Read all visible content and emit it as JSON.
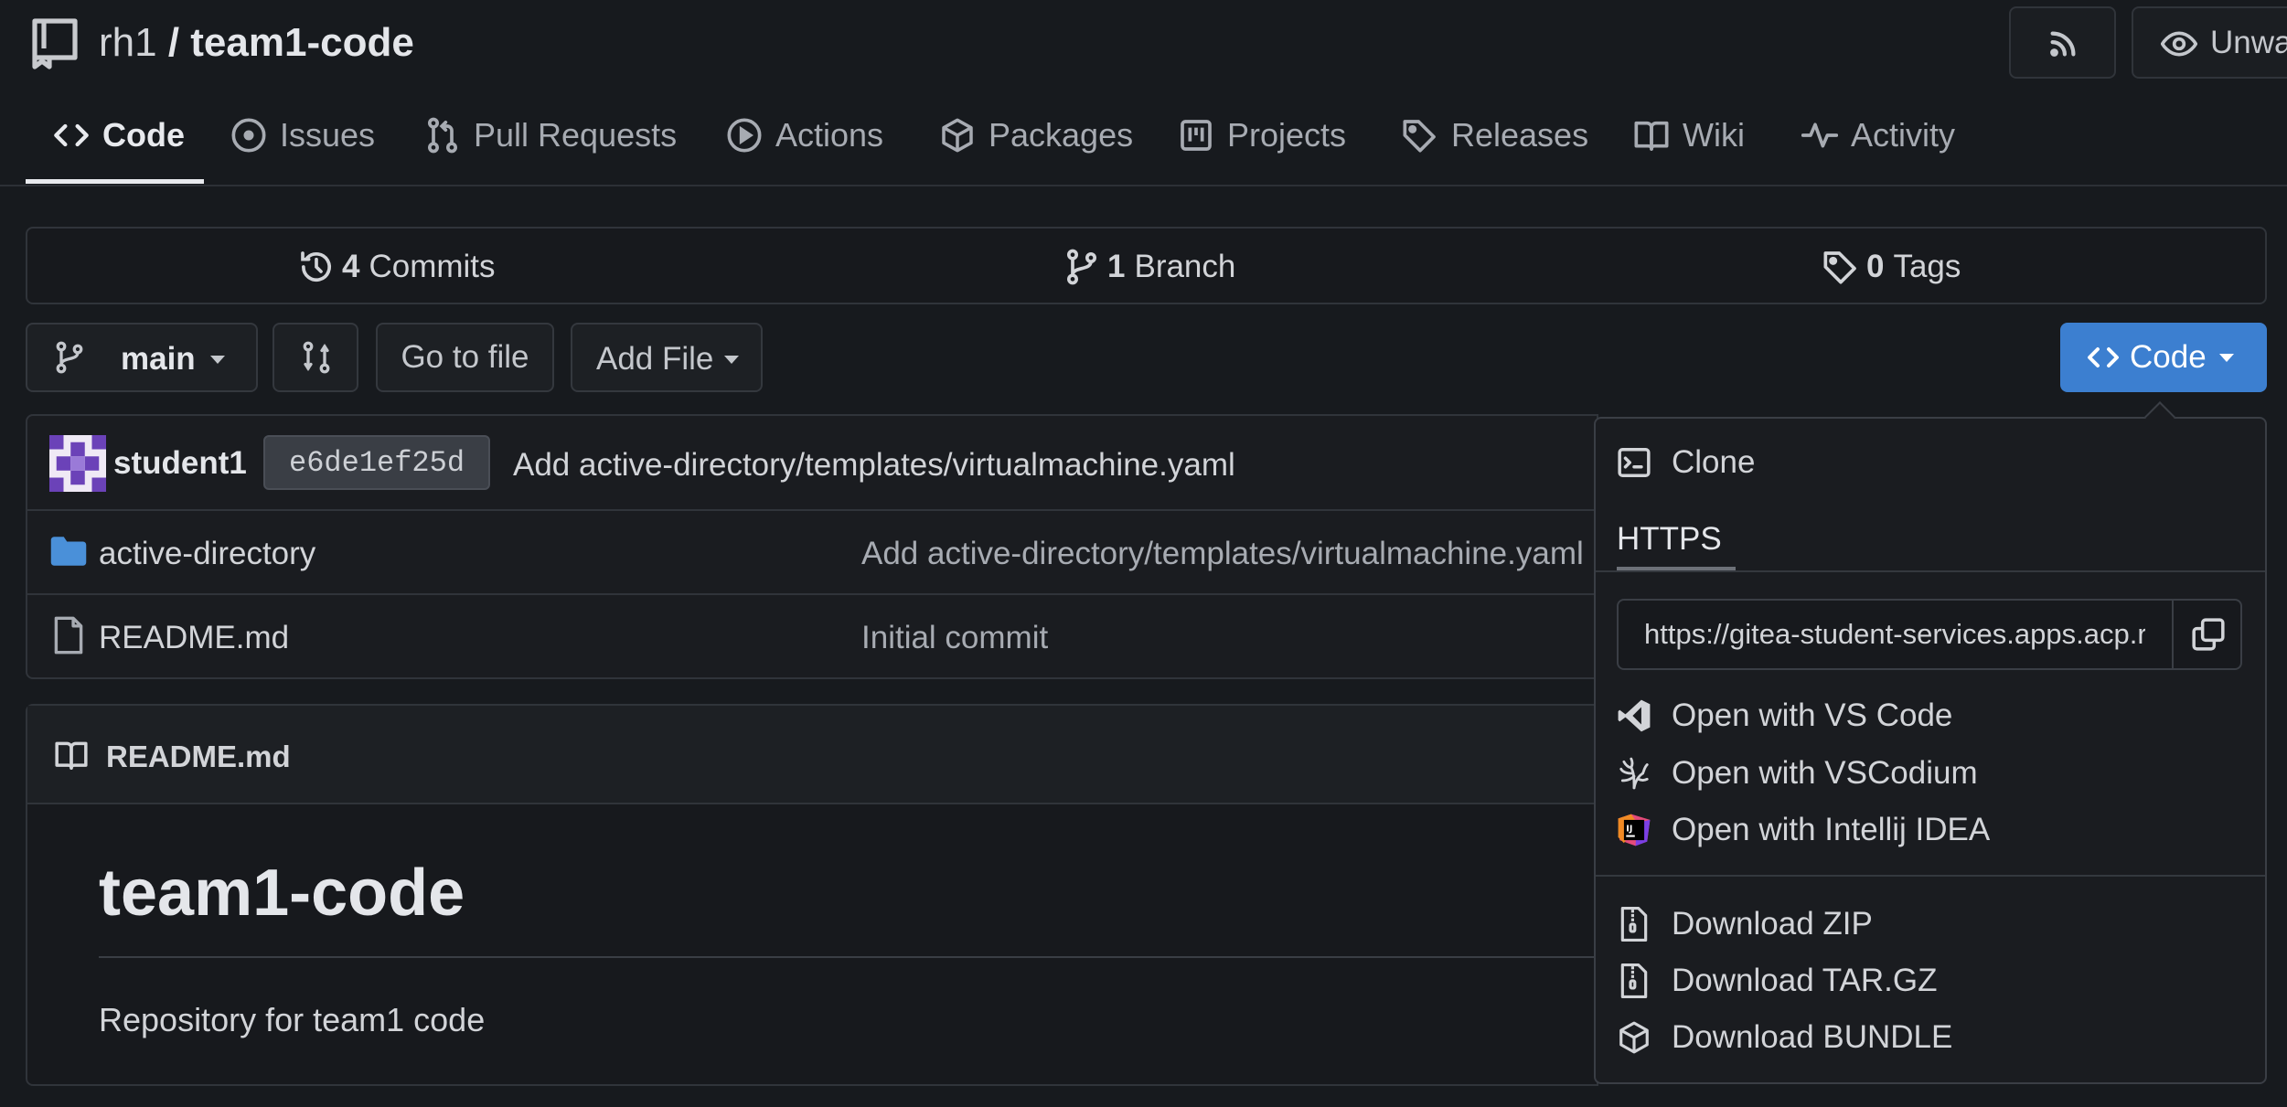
{
  "header": {
    "owner": "rh1",
    "separator": " / ",
    "repo": "team1-code",
    "watch_label": "Unwa"
  },
  "tabs": [
    {
      "label": "Code",
      "icon": "code-icon",
      "active": true
    },
    {
      "label": "Issues",
      "icon": "issue-icon"
    },
    {
      "label": "Pull Requests",
      "icon": "pull-request-icon"
    },
    {
      "label": "Actions",
      "icon": "play-icon"
    },
    {
      "label": "Packages",
      "icon": "package-icon"
    },
    {
      "label": "Projects",
      "icon": "project-icon"
    },
    {
      "label": "Releases",
      "icon": "tag-icon"
    },
    {
      "label": "Wiki",
      "icon": "book-icon"
    },
    {
      "label": "Activity",
      "icon": "pulse-icon"
    }
  ],
  "stats": {
    "commits_count": "4",
    "commits_label": "Commits",
    "branches_count": "1",
    "branches_label": "Branch",
    "tags_count": "0",
    "tags_label": "Tags"
  },
  "toolbar": {
    "branch": "main",
    "go_to_file": "Go to file",
    "add_file": "Add File",
    "code_button": "Code"
  },
  "latest_commit": {
    "author": "student1",
    "sha": "e6de1ef25d",
    "message": "Add active-directory/templates/virtualmachine.yaml"
  },
  "files": [
    {
      "name": "active-directory",
      "type": "folder",
      "commit": "Add active-directory/templates/virtualmachine.yaml"
    },
    {
      "name": "README.md",
      "type": "file",
      "commit": "Initial commit"
    }
  ],
  "readme": {
    "filename": "README.md",
    "heading": "team1-code",
    "body": "Repository for team1 code"
  },
  "clone_menu": {
    "title": "Clone",
    "protocol_tab": "HTTPS",
    "url": "https://gitea-student-services.apps.acp.r",
    "open_vscode": "Open with VS Code",
    "open_vscodium": "Open with VSCodium",
    "open_intellij": "Open with Intellij IDEA",
    "download_zip": "Download ZIP",
    "download_targz": "Download TAR.GZ",
    "download_bundle": "Download BUNDLE"
  },
  "colors": {
    "background": "#171a1e",
    "accent": "#3c7fd0",
    "folder": "#4a90d9"
  }
}
